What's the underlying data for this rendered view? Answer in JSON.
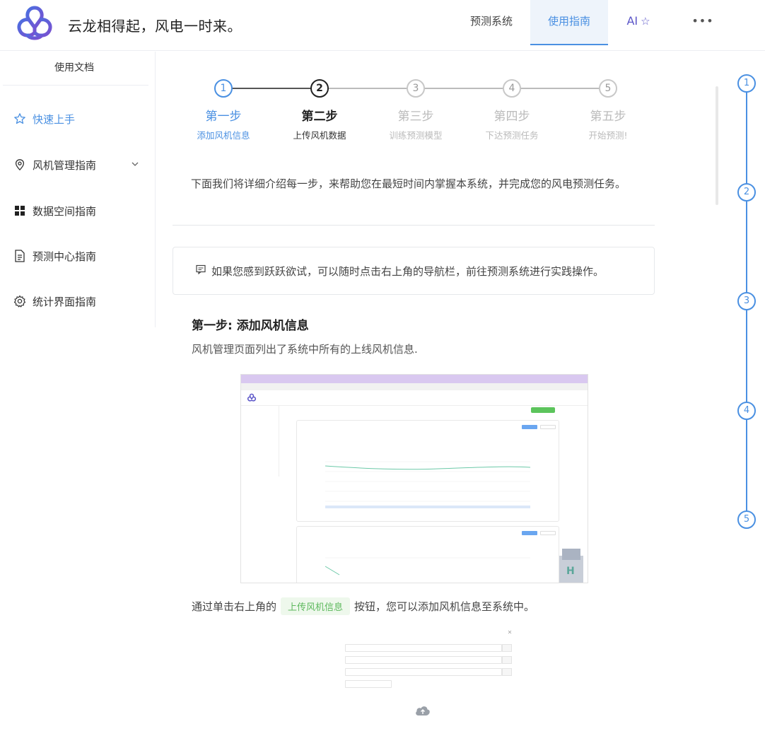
{
  "header": {
    "slogan": "云龙相得起，风电一时来。",
    "nav": {
      "predict": "预测系统",
      "guide": "使用指南",
      "ai": "AI",
      "more": "•••"
    }
  },
  "sidebar": {
    "title": "使用文档",
    "items": [
      {
        "label": "快速上手",
        "icon": "star-icon"
      },
      {
        "label": "风机管理指南",
        "icon": "location-pin-icon"
      },
      {
        "label": "数据空间指南",
        "icon": "grid-icon"
      },
      {
        "label": "预测中心指南",
        "icon": "document-icon"
      },
      {
        "label": "统计界面指南",
        "icon": "gear-icon"
      }
    ]
  },
  "steps": [
    {
      "num": "1",
      "title": "第一步",
      "desc": "添加风机信息",
      "state": "done"
    },
    {
      "num": "2",
      "title": "第二步",
      "desc": "上传风机数据",
      "state": "current"
    },
    {
      "num": "3",
      "title": "第三步",
      "desc": "训练预测模型",
      "state": "todo"
    },
    {
      "num": "4",
      "title": "第四步",
      "desc": "下达预测任务",
      "state": "todo"
    },
    {
      "num": "5",
      "title": "第五步",
      "desc": "开始预测!",
      "state": "todo"
    }
  ],
  "intro": "下面我们将详细介绍每一步，来帮助您在最短时间内掌握本系统，并完成您的风电预测任务。",
  "tip": "如果您感到跃跃欲试，可以随时点击右上角的导航栏，前往预测系统进行实践操作。",
  "section1": {
    "title": "第一步: 添加风机信息",
    "text": "风机管理页面列出了系统中所有的上线风机信息."
  },
  "upload": {
    "before": "通过单击右上角的",
    "chip": "上传风机信息",
    "after": "按钮，您可以添加风机信息至系统中。"
  },
  "anchors": [
    "1",
    "2",
    "3",
    "4",
    "5"
  ],
  "colors": {
    "accent": "#4a90e2",
    "brand_purple": "#5b55c8",
    "success": "#5cb85c"
  }
}
